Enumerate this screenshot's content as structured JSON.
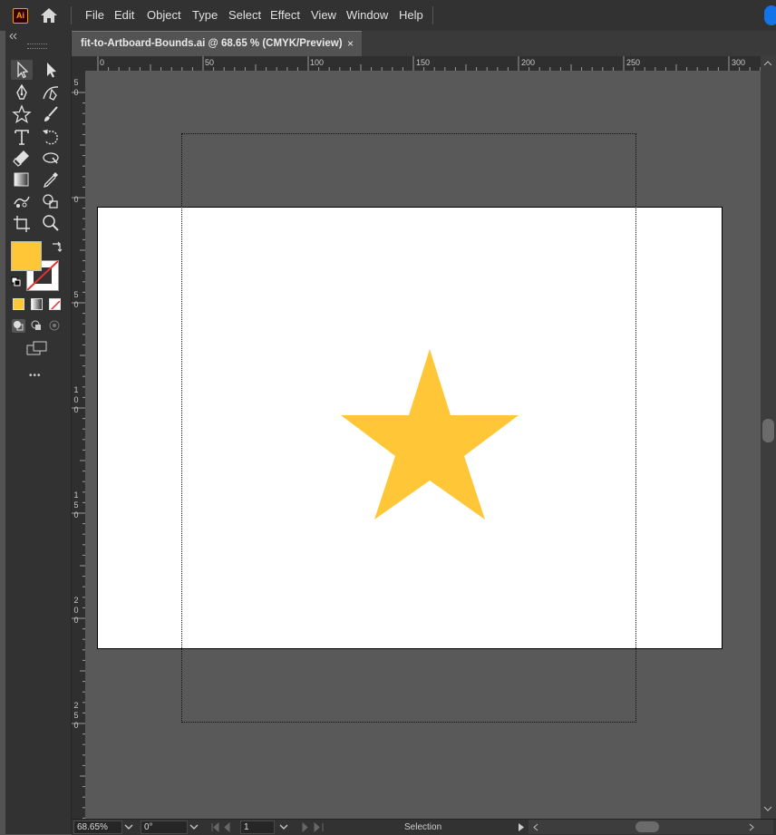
{
  "menu": {
    "logo": "Ai",
    "items": [
      "File",
      "Edit",
      "Object",
      "Type",
      "Select",
      "Effect",
      "View",
      "Window",
      "Help"
    ]
  },
  "tab": {
    "title": "fit-to-Artboard-Bounds.ai @ 68.65 % (CMYK/Preview)",
    "close": "×"
  },
  "ruler": {
    "horizontal": [
      "0",
      "50",
      "100",
      "150",
      "200",
      "250",
      "300"
    ],
    "vertical": [
      "5\n0",
      "0",
      "5\n0",
      "1\n0\n0",
      "1\n5\n0",
      "2\n0\n0",
      "2\n5\n0"
    ]
  },
  "colors": {
    "fill": "#ffc637",
    "star": "#ffc637",
    "accent": "#1473e6"
  },
  "toolbar": {
    "more": "•••"
  },
  "status": {
    "zoom": "68.65%",
    "rotation": "0°",
    "artboard": "1",
    "mode": "Selection"
  }
}
